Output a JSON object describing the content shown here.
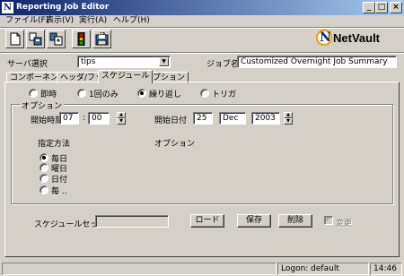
{
  "window": {
    "title": "Reporting Job Editor",
    "minimize_glyph": "_",
    "maximize_glyph": "□",
    "close_glyph": "×"
  },
  "menu": [
    {
      "label": "ファイル(F)"
    },
    {
      "label": "表示(V)"
    },
    {
      "label": "実行(A)"
    },
    {
      "label": "ヘルプ(H)"
    }
  ],
  "toolbar": {
    "icons": [
      "new-document-icon",
      "copy-job-icon",
      "move-job-icon",
      "traffic-light-icon",
      "save-job-icon"
    ]
  },
  "logo": {
    "letter": "N",
    "text": "NetVault"
  },
  "server": {
    "label": "サーバ選択",
    "value": "tips",
    "dropdown_glyph": "▼"
  },
  "job": {
    "label": "ジョブ名",
    "value": "Customized Overnight Job Summary"
  },
  "tabs": [
    {
      "label": "コンポーネント",
      "active": false
    },
    {
      "label": "ヘッダ/フッタ",
      "active": false
    },
    {
      "label": "スケジュール",
      "active": true
    },
    {
      "label": "オプション",
      "active": false
    }
  ],
  "schedule_type": {
    "options": [
      {
        "label": "即時",
        "checked": false
      },
      {
        "label": "1回のみ",
        "checked": false
      },
      {
        "label": "繰り返し",
        "checked": true
      },
      {
        "label": "トリガ",
        "checked": false
      }
    ]
  },
  "options_group": {
    "legend": "オプション",
    "start_time": {
      "label": "開始時刻",
      "hour": "07",
      "separator": ":",
      "minute": "00"
    },
    "start_date": {
      "label": "開始日付",
      "day": "25",
      "month": "Dec",
      "year": "2003"
    },
    "method_label": "指定方法",
    "option_label": "オプション",
    "methods": [
      {
        "label": "毎日",
        "checked": true
      },
      {
        "label": "曜日",
        "checked": false
      },
      {
        "label": "日付",
        "checked": false
      },
      {
        "label": "毎 ..",
        "checked": false
      }
    ],
    "spin_up_glyph": "▲",
    "spin_down_glyph": "▼"
  },
  "schedule_set": {
    "label": "スケジュールセット",
    "value": "",
    "load_label": "ロード",
    "save_label": "保存",
    "delete_label": "削除",
    "change_label": "変更",
    "change_checked": true,
    "tick_glyph": "✓"
  },
  "status": {
    "logon": "Logon: default",
    "time": "14:46"
  },
  "colors": {
    "titlebar": "#0a246a",
    "face": "#d4d0c8"
  }
}
